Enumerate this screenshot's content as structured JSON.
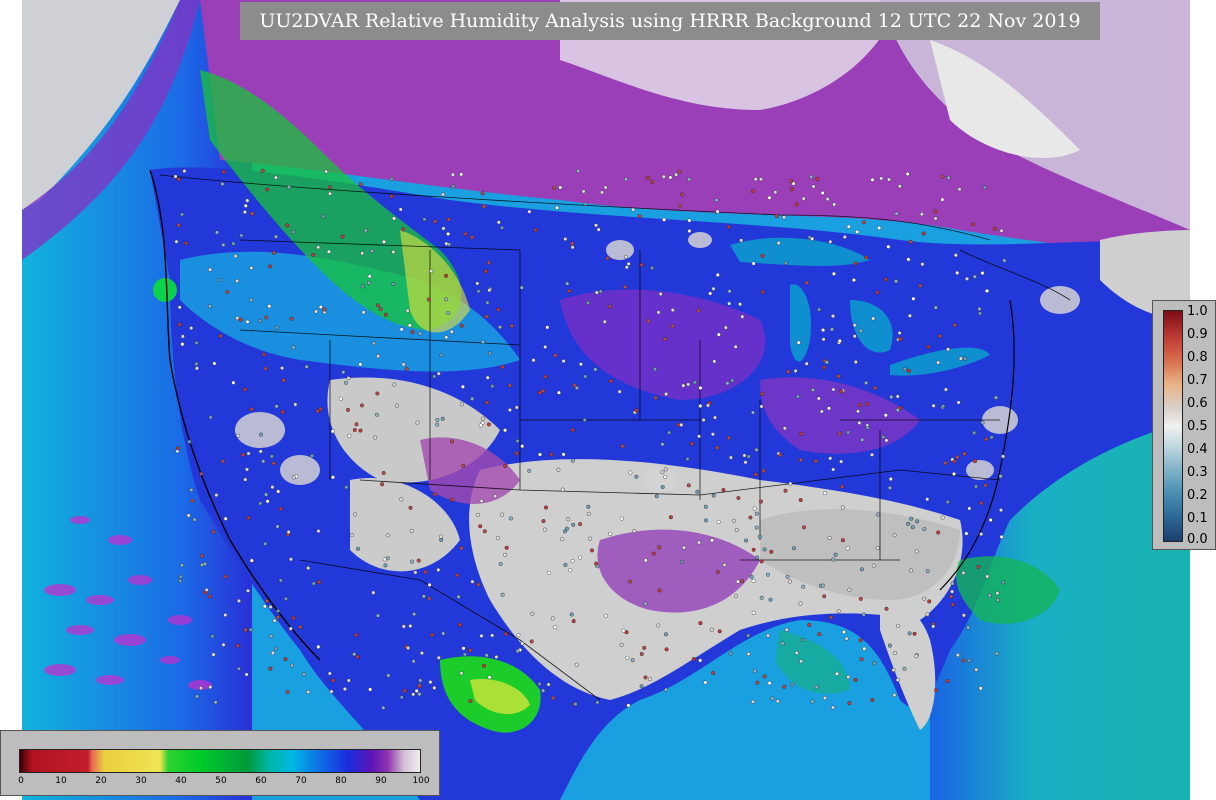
{
  "title": "UU2DVAR Relative Humidity Analysis using HRRR Background 12 UTC 22 Nov 2019",
  "colorbar_right": {
    "ticks": [
      "1.0",
      "0.9",
      "0.8",
      "0.7",
      "0.6",
      "0.5",
      "0.4",
      "0.3",
      "0.2",
      "0.1",
      "0.0"
    ]
  },
  "colorbar_bottom": {
    "ticks": [
      "0",
      "10",
      "20",
      "30",
      "40",
      "50",
      "60",
      "70",
      "80",
      "90",
      "100"
    ]
  },
  "colors": {
    "ocean": "#1aa0e0",
    "land_dry": "#d3d3d3",
    "humid": "#1c2fe0",
    "very_humid": "#8e2aa8",
    "green": "#1fcf3a"
  }
}
